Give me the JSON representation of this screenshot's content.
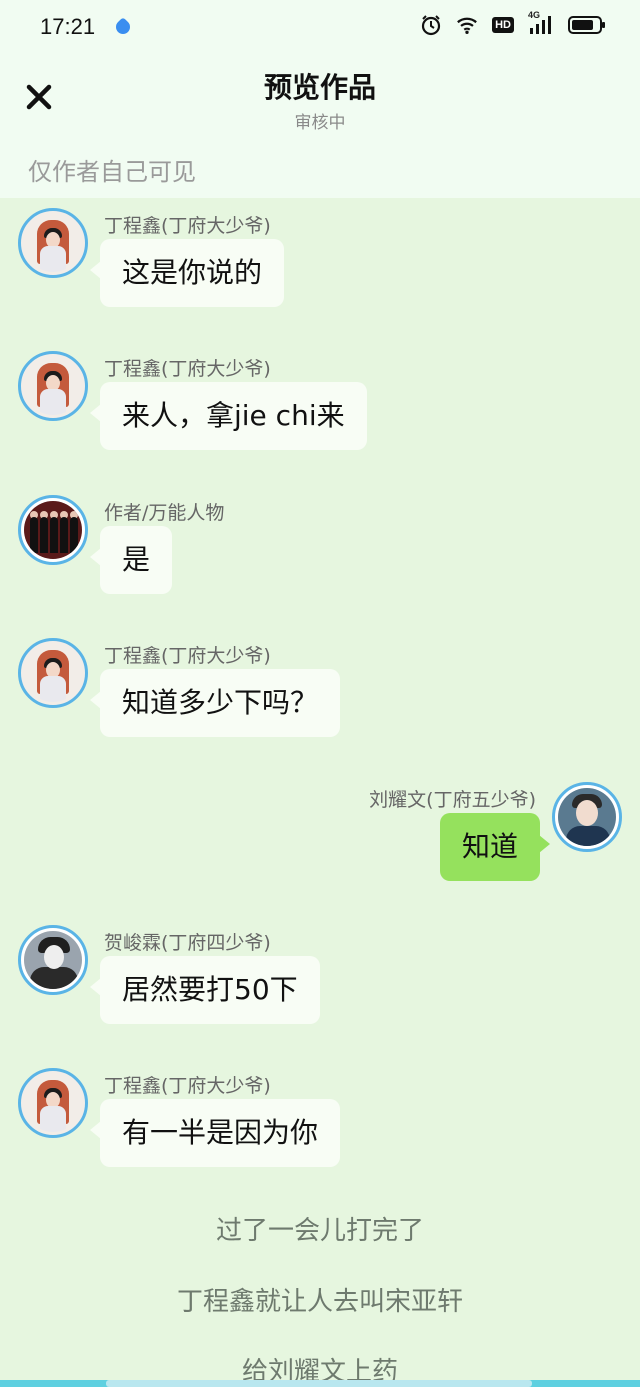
{
  "status_bar": {
    "time": "17:21",
    "app_icon": "app-notification-icon",
    "icons": [
      "alarm-icon",
      "wifi-icon",
      "hd-icon",
      "signal-4g-icon",
      "battery-icon"
    ],
    "hd_label": "HD",
    "network_label": "4G",
    "battery_level": 0.8
  },
  "header": {
    "close_icon": "close-icon",
    "title": "预览作品",
    "subtitle": "审核中"
  },
  "visibility_note": "仅作者自己可见",
  "messages": [
    {
      "sender": "丁程鑫(丁府大少爷)",
      "text": "这是你说的",
      "side": "left",
      "avatar": "ding-avatar"
    },
    {
      "sender": "丁程鑫(丁府大少爷)",
      "text": "来人，拿jie chi来",
      "side": "left",
      "avatar": "ding-avatar"
    },
    {
      "sender": "作者/万能人物",
      "text": "是",
      "side": "left",
      "avatar": "group-avatar"
    },
    {
      "sender": "丁程鑫(丁府大少爷)",
      "text": "知道多少下吗？",
      "side": "left",
      "avatar": "ding-avatar"
    },
    {
      "sender": "刘耀文(丁府五少爷)",
      "text": "知道",
      "side": "right",
      "avatar": "liu-avatar"
    },
    {
      "sender": "贺峻霖(丁府四少爷)",
      "text": "居然要打50下",
      "side": "left",
      "avatar": "he-avatar"
    },
    {
      "sender": "丁程鑫(丁府大少爷)",
      "text": "有一半是因为你",
      "side": "left",
      "avatar": "ding-avatar"
    }
  ],
  "narration": [
    "过了一会儿打完了",
    "丁程鑫就让人去叫宋亚轩",
    "给刘耀文上药"
  ],
  "colors": {
    "chat_background": "#e6f6df",
    "header_background": "#f1fcf2",
    "bubble_left": "#f8fdf5",
    "bubble_right": "#95e15d",
    "avatar_ring": "#5ab4e6"
  }
}
